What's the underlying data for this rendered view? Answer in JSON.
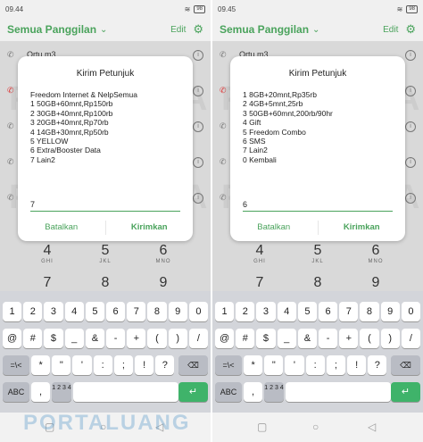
{
  "screens": [
    {
      "status": {
        "time": "09.44",
        "battery": "98"
      },
      "header": {
        "title": "Semua Panggilan",
        "edit": "Edit"
      },
      "contact": "Ortu m3",
      "dialog": {
        "title": "Kirim Petunjuk",
        "lines": [
          "Freedom Internet & NelpSemua",
          "1 50GB+60mnt,Rp150rb",
          "2 30GB+40mnt,Rp100rb",
          "3 20GB+40mnt,Rp70rb",
          "4 14GB+30mnt,Rp50rb",
          "5 YELLOW",
          "6 Extra/Booster Data",
          "7 Lain2"
        ],
        "input_value": "7",
        "cancel": "Batalkan",
        "send": "Kirimkan"
      }
    },
    {
      "status": {
        "time": "09.45",
        "battery": "98"
      },
      "header": {
        "title": "Semua Panggilan",
        "edit": "Edit"
      },
      "contact": "Ortu m3",
      "dialog": {
        "title": "Kirim Petunjuk",
        "lines": [
          "1 8GB+20mnt,Rp35rb",
          "2 4GB+5mnt,25rb",
          "3 50GB+60mnt,200rb/90hr",
          "4 Gift",
          "5 Freedom Combo",
          "6 SMS",
          "7 Lain2",
          "0 Kembali"
        ],
        "input_value": "6",
        "cancel": "Batalkan",
        "send": "Kirimkan"
      }
    }
  ],
  "dialer": {
    "keys": [
      {
        "num": "4",
        "letters": "GHI"
      },
      {
        "num": "5",
        "letters": "JKL"
      },
      {
        "num": "6",
        "letters": "MNO"
      },
      {
        "num": "7",
        "letters": ""
      },
      {
        "num": "8",
        "letters": ""
      },
      {
        "num": "9",
        "letters": ""
      }
    ]
  },
  "keyboard": {
    "row1": [
      "1",
      "2",
      "3",
      "4",
      "5",
      "6",
      "7",
      "8",
      "9",
      "0"
    ],
    "row2": [
      "@",
      "#",
      "$",
      "_",
      "&",
      "-",
      "+",
      "(",
      ")",
      "/"
    ],
    "row3": [
      "=\\<",
      "*",
      "\"",
      "'",
      ":",
      ";",
      "!",
      "?"
    ],
    "abc": "ABC",
    "comma": ",",
    "numlayout": "1 2 3 4"
  },
  "watermark": "PORTALUANG",
  "colors": {
    "accent": "#4aa35c",
    "enter": "#3fb36a"
  }
}
